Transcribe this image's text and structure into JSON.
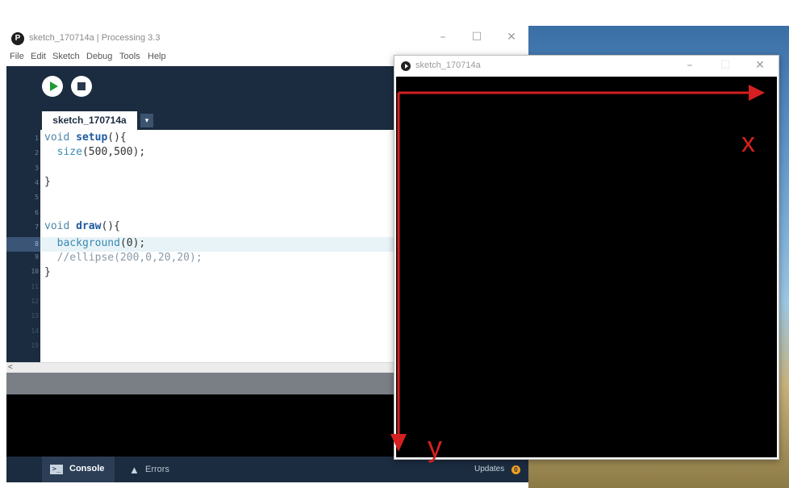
{
  "ide": {
    "title": "sketch_170714a | Processing 3.3",
    "window_controls": {
      "minimize": "–",
      "maximize": "☐",
      "close": "✕"
    },
    "menu": [
      "File",
      "Edit",
      "Sketch",
      "Debug",
      "Tools",
      "Help"
    ],
    "toolbar": {
      "run_icon": "play-icon",
      "stop_icon": "stop-icon"
    },
    "tab": {
      "label": "sketch_170714a",
      "dropdown": "▾"
    },
    "line_numbers": [
      "1",
      "2",
      "3",
      "4",
      "5",
      "6",
      "7",
      "8",
      "9",
      "10",
      "11",
      "12",
      "13",
      "14",
      "15"
    ],
    "code_lines": [
      "void setup(){",
      "  size(500,500);",
      "",
      "}",
      "",
      "",
      "void draw(){",
      "  background(0);",
      "  //ellipse(200,0,20,20);",
      "}"
    ],
    "highlighted_line": 8,
    "hscroll_arrow": "<",
    "footer": {
      "console_label": "Console",
      "console_icon": ">_",
      "errors_label": "Errors",
      "errors_icon": "▲",
      "updates_label": "Updates",
      "updates_count": "0"
    }
  },
  "sketch_window": {
    "title": "sketch_170714a",
    "window_controls": {
      "minimize": "–",
      "maximize": "☐",
      "close": "✕"
    }
  },
  "annotations": {
    "x_label": "x",
    "y_label": "y",
    "arrow_color": "#d42020"
  }
}
